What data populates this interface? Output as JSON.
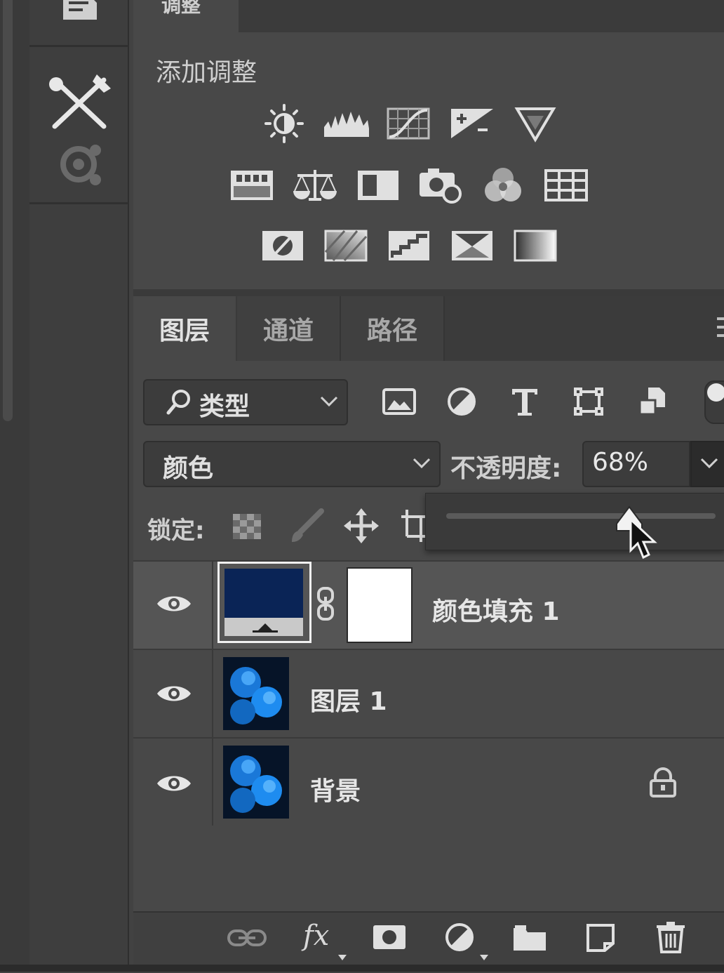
{
  "adjustments_panel": {
    "tab_label": "调整",
    "title": "添加调整",
    "icons_row1": [
      "brightness-contrast-icon",
      "levels-icon",
      "curves-icon",
      "exposure-icon",
      "vibrance-icon"
    ],
    "icons_row2": [
      "hue-saturation-icon",
      "color-balance-icon",
      "black-white-icon",
      "photo-filter-icon",
      "channel-mixer-icon",
      "color-lookup-icon"
    ],
    "icons_row3": [
      "invert-icon",
      "posterize-icon",
      "threshold-icon",
      "selective-color-icon",
      "gradient-map-icon"
    ]
  },
  "layers_panel": {
    "tabs": [
      "图层",
      "通道",
      "路径"
    ],
    "active_tab": "图层",
    "filter": {
      "label": "类型"
    },
    "filter_icons": [
      "pixel-layer-filter-icon",
      "adjustment-layer-filter-icon",
      "type-layer-filter-icon",
      "shape-layer-filter-icon",
      "smart-object-filter-icon"
    ],
    "blend_mode": "颜色",
    "opacity_label": "不透明度:",
    "opacity_value": "68%",
    "opacity_fraction": 0.68,
    "lock_label": "锁定:",
    "lock_icons": [
      "lock-transparent-pixels-icon",
      "lock-image-pixels-icon",
      "lock-position-icon",
      "lock-artboard-icon"
    ],
    "layers": [
      {
        "name": "颜色填充 1",
        "visible": true,
        "selected": true,
        "type": "fill",
        "fill_color": "#0a2456"
      },
      {
        "name": "图层 1",
        "visible": true,
        "selected": false,
        "type": "pixel"
      },
      {
        "name": "背景",
        "visible": true,
        "selected": false,
        "type": "background",
        "locked": true
      }
    ],
    "bottom_icons": [
      "link-layers-icon",
      "layer-style-icon",
      "add-mask-icon",
      "new-adjustment-icon",
      "new-group-icon",
      "new-layer-icon",
      "delete-layer-icon"
    ],
    "fx_label": "fx"
  }
}
